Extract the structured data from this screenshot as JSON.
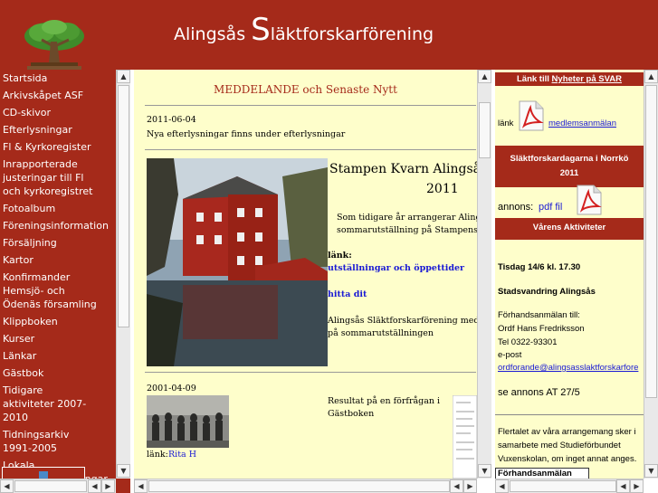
{
  "header": {
    "title_part1": "Alingsås",
    "title_big_letter": "S",
    "title_part2": "läktforskarförening"
  },
  "nav": {
    "items": [
      "Startsida",
      "Arkivskåpet ASF",
      "CD-skivor",
      "Efterlysningar",
      "Fl & Kyrkoregister",
      "Inrapporterade justeringar till Fl och kyrkoregistret",
      "Fotoalbum",
      "Föreningsinformation",
      "Försäljning",
      "Kartor",
      "Konfirmander Hemsjö- och Ödenäs församling",
      "Klippboken",
      "Kurser",
      "Länkar",
      "Gästbok",
      "Tidigare aktiviteter 2007-2010",
      "Tidningsarkiv 1991-2005",
      "Lokala Hembygdsföreningar"
    ]
  },
  "news": {
    "heading": "MEDDELANDE och Senaste Nytt",
    "entry1_date": "2011-06-04",
    "entry1_text": "Nya efterlysningar finns under efterlysningar",
    "entry2_title": "Stampen Kvarn Alingsås",
    "entry2_year": "2011",
    "entry2_text1": "Som tidigare år arrangerar Alingsås l",
    "entry2_text2": "sommarutställning på Stampens K",
    "entry2_link_label": "länk:",
    "entry2_link1": "utställningar och öppettider",
    "entry2_link2": "hitta dit",
    "entry2_text3": "Alingsås Släktforskarförening medverk",
    "entry2_text4": "på sommarutställningen",
    "entry3_date": "2001-04-09",
    "entry3_text1": "Resultat på en förfrågan i",
    "entry3_text2": "Gästboken",
    "entry3_link_label": "länk:",
    "entry3_link": "Rita H"
  },
  "right": {
    "bar1_prefix": "Länk till ",
    "bar1_link": "Nyheter på SVAR",
    "link_label": "länk",
    "link_text": "medlemsanmälan",
    "bar2_line1": "Släktforskardagarna i Norrkö",
    "bar2_line2": "2011",
    "annons_label": "annons:",
    "annons_link": "pdf fil",
    "bar3": "Vårens  Aktiviteter",
    "event_date": "Tisdag 14/6 kl. 17.30",
    "event_title": "Stadsvandring Alingsås",
    "prereg_label": "Förhandsanmälan till:",
    "contact_name": "Ordf Hans Fredriksson",
    "contact_tel": "Tel 0322-93301",
    "contact_email_label": "e-post",
    "contact_email": "ordforande@alingsasslaktforskarfore",
    "see_ad": "se annons AT 27/5",
    "footer_line1": "Flertalet av våra arrangemang sker i",
    "footer_line2": "samarbete med Studieförbundet",
    "footer_line3": "Vuxenskolan, om inget annat anges.",
    "prereg_box": "Förhandsanmälan"
  },
  "colors": {
    "brand_red": "#a52a1a",
    "content_bg": "#fefecb",
    "link_blue": "#1a1ad4"
  },
  "icons": [
    "tree-logo-icon",
    "pdf-icon",
    "scroll-up-icon",
    "scroll-down-icon",
    "scroll-left-icon",
    "scroll-right-icon"
  ]
}
